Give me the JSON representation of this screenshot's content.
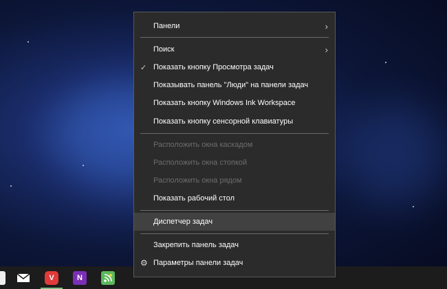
{
  "menu": {
    "panels": "Панели",
    "search": "Поиск",
    "show_task_view": "Показать кнопку Просмотра задач",
    "show_people": "Показывать панель \"Люди\" на панели задач",
    "show_ink": "Показать кнопку Windows Ink Workspace",
    "show_keyboard": "Показать кнопку сенсорной клавиатуры",
    "cascade": "Расположить окна каскадом",
    "stack": "Расположить окна стопкой",
    "side_by_side": "Расположить окна рядом",
    "show_desktop": "Показать рабочий стол",
    "task_manager": "Диспетчер задач",
    "lock_taskbar": "Закрепить панель задач",
    "taskbar_settings": "Параметры панели задач"
  },
  "taskbar": {
    "icons": [
      "mail-icon",
      "vivaldi-icon",
      "onenote-icon",
      "feed-reader-icon"
    ],
    "onenote_label": "N",
    "vivaldi_label": "V"
  }
}
